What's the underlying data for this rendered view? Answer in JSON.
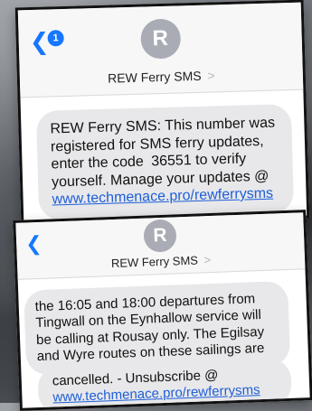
{
  "conversation_top": {
    "badge_count": "1",
    "avatar_initial": "R",
    "contact_name": "REW Ferry SMS",
    "contact_chevron": ">",
    "message": {
      "prefix": "REW Ferry SMS: This number was registered for SMS ferry updates, enter the code",
      "code": "36551",
      "suffix": "to verify yourself. Manage your updates @",
      "link": "www.techmenace.pro/rewferrysms"
    }
  },
  "conversation_bottom": {
    "avatar_initial": "R",
    "contact_name": "REW Ferry SMS",
    "contact_chevron": ">",
    "message_1": "the 16:05 and 18:00 departures from Tingwall on the Eynhallow service will be calling at Rousay only. The Egilsay and Wyre routes on these sailings are",
    "message_2_prefix": "cancelled. - Unsubscribe @",
    "message_2_link": "www.techmenace.pro/rewferrysms"
  },
  "icons": {
    "back": "chevron-left-icon",
    "badge": "notification-badge"
  },
  "colors": {
    "accent": "#1677ff",
    "bubble": "#e8e8ea",
    "avatar": "#a9acb4",
    "link": "#1f5fd8"
  }
}
